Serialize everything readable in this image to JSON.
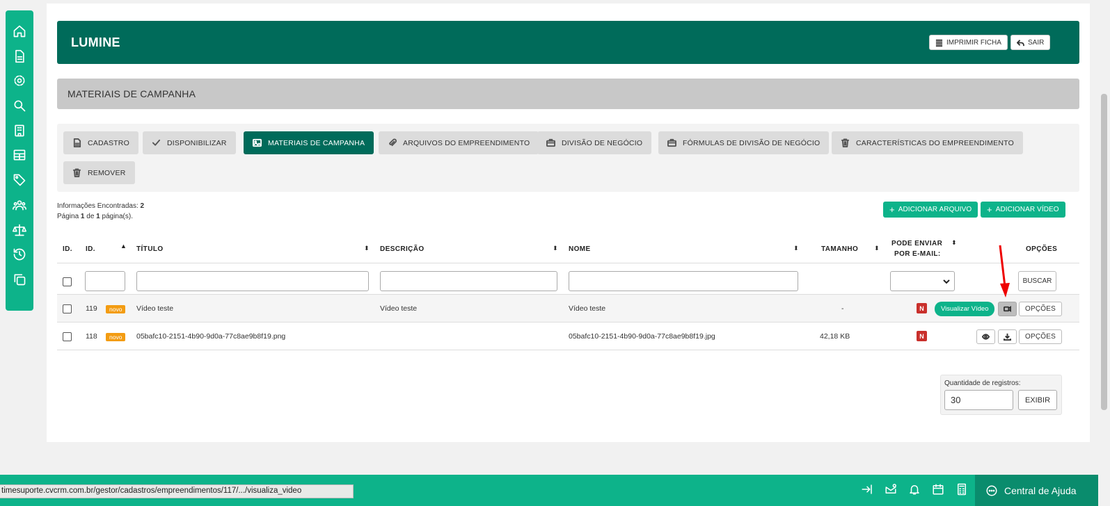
{
  "app": {
    "title": "LUMINE"
  },
  "header": {
    "print_label": "IMPRIMIR FICHA",
    "exit_label": "SAIR"
  },
  "section": {
    "title": "MATERIAIS DE CAMPANHA"
  },
  "tabs": [
    {
      "label": "CADASTRO",
      "icon": "document-icon",
      "active": false
    },
    {
      "label": "DISPONIBILIZAR",
      "icon": "check-icon",
      "active": false
    },
    {
      "label": "MATERIAIS DE CAMPANHA",
      "icon": "image-icon",
      "active": true
    },
    {
      "label": "ARQUIVOS DO EMPREENDIMENTO",
      "icon": "paperclip-icon",
      "active": false
    },
    {
      "label": "DIVISÃO DE NEGÓCIO",
      "icon": "briefcase-icon",
      "active": false
    },
    {
      "label": "FÓRMULAS DE DIVISÃO DE NEGÓCIO",
      "icon": "briefcase-icon",
      "active": false
    },
    {
      "label": "CARACTERÍSTICAS DO EMPREENDIMENTO",
      "icon": "trash-icon",
      "active": false
    },
    {
      "label": "REMOVER",
      "icon": "trash-icon",
      "active": false
    }
  ],
  "info": {
    "found_label": "Informações Encontradas:",
    "found_count": "2",
    "page_prefix": "Página",
    "page_current": "1",
    "page_of": "de",
    "page_total": "1",
    "page_suffix": "página(s)."
  },
  "actions": {
    "add_file": "ADICIONAR ARQUIVO",
    "add_video": "ADICIONAR VÍDEO"
  },
  "table": {
    "headers": {
      "id_check": "ID.",
      "id": "ID.",
      "title": "TÍTULO",
      "description": "DESCRIÇÃO",
      "name": "NOME",
      "size": "TAMANHO",
      "email_line1": "PODE ENVIAR",
      "email_line2": "POR E-MAIL:",
      "options": "OPÇÕES"
    },
    "search_label": "BUSCAR",
    "rows": [
      {
        "id": "119",
        "badge": "novo",
        "title": "Vídeo teste",
        "description": "Vídeo teste",
        "name": "Vídeo teste",
        "size": "-",
        "email": "N",
        "tooltip": "Visualizar Vídeo",
        "options": "OPÇÕES"
      },
      {
        "id": "118",
        "badge": "novo",
        "title": "05bafc10-2151-4b90-9d0a-77c8ae9b8f19.png",
        "description": "",
        "name": "05bafc10-2151-4b90-9d0a-77c8ae9b8f19.jpg",
        "size": "42,18 KB",
        "email": "N",
        "options": "OPÇÕES"
      }
    ]
  },
  "pagination": {
    "qty_label": "Quantidade de registros:",
    "qty_value": "30",
    "show_label": "EXIBIR"
  },
  "footer": {
    "help_label": "Central de Ajuda",
    "status_url": "timesuporte.cvcrm.com.br/gestor/cadastros/empreendimentos/117/.../visualiza_video"
  },
  "colors": {
    "brand_dark": "#006b5a",
    "brand": "#0db38a",
    "danger": "#c9302c",
    "badge": "#f39c12"
  }
}
